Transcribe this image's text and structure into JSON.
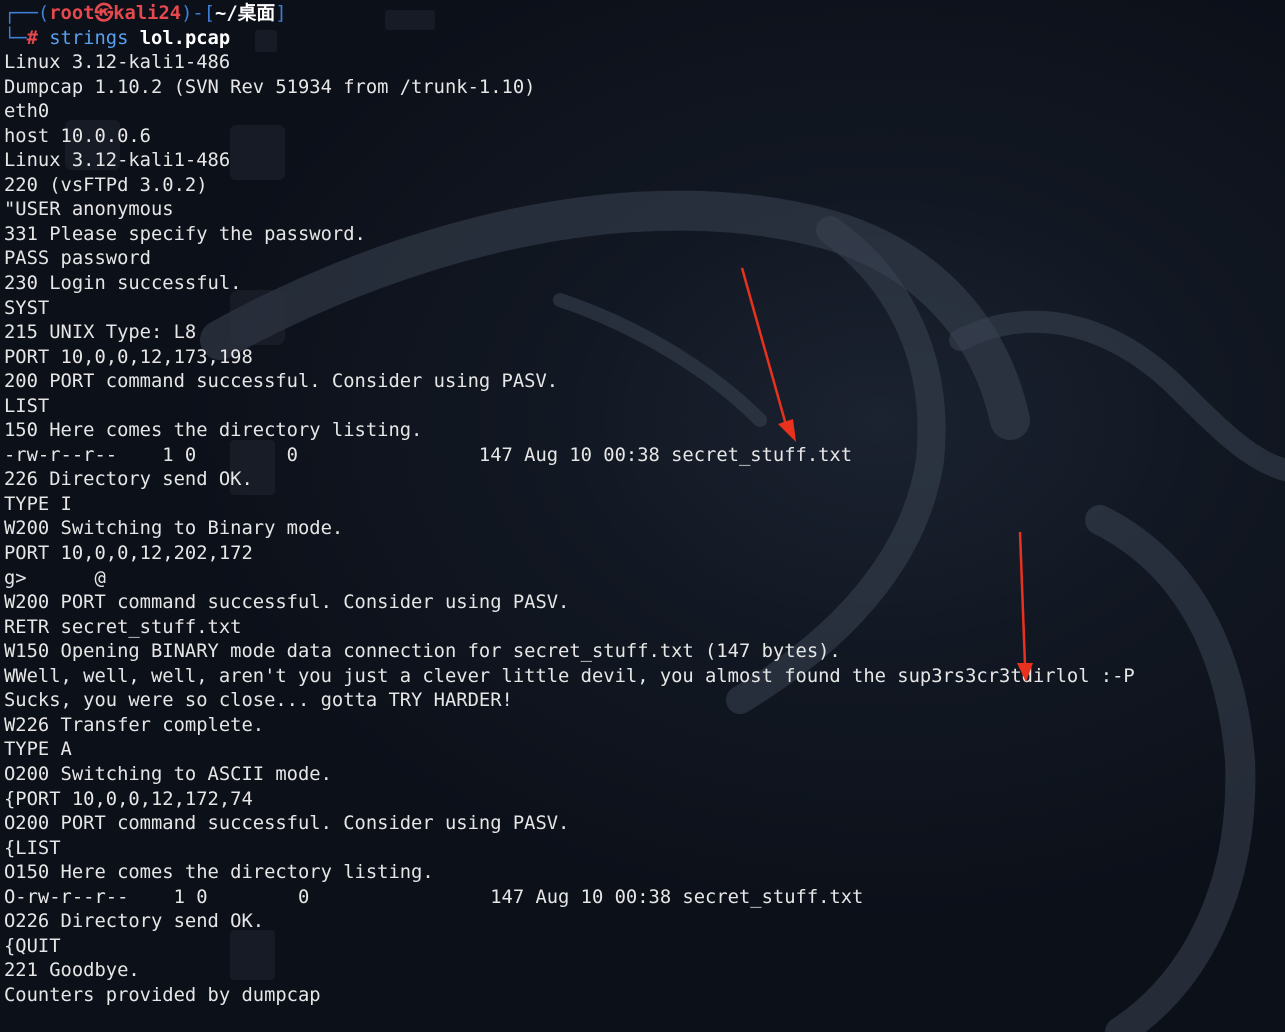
{
  "prompt": {
    "frame_open": "┌──(",
    "user": "root㉿kali24",
    "frame_mid": ")-[",
    "path": "~/桌面",
    "frame_close": "]",
    "frame_bottom": "└─",
    "hash": "#",
    "command": "strings",
    "argument": "lol.pcap"
  },
  "output_lines": [
    "Linux 3.12-kali1-486",
    "Dumpcap 1.10.2 (SVN Rev 51934 from /trunk-1.10)",
    "eth0",
    "host 10.0.0.6",
    "Linux 3.12-kali1-486",
    "220 (vsFTPd 3.0.2)",
    "\"USER anonymous",
    "331 Please specify the password.",
    "PASS password",
    "230 Login successful.",
    "SYST",
    "215 UNIX Type: L8",
    "PORT 10,0,0,12,173,198",
    "200 PORT command successful. Consider using PASV.",
    "LIST",
    "150 Here comes the directory listing.",
    "-rw-r--r--    1 0        0                147 Aug 10 00:38 secret_stuff.txt",
    "226 Directory send OK.",
    "TYPE I",
    "W200 Switching to Binary mode.",
    "PORT 10,0,0,12,202,172",
    "g>      @",
    "W200 PORT command successful. Consider using PASV.",
    "RETR secret_stuff.txt",
    "W150 Opening BINARY mode data connection for secret_stuff.txt (147 bytes).",
    "WWell, well, well, aren't you just a clever little devil, you almost found the sup3rs3cr3tdirlol :-P",
    "Sucks, you were so close... gotta TRY HARDER!",
    "W226 Transfer complete.",
    "TYPE A",
    "O200 Switching to ASCII mode.",
    "{PORT 10,0,0,12,172,74",
    "O200 PORT command successful. Consider using PASV.",
    "{LIST",
    "O150 Here comes the directory listing.",
    "O-rw-r--r--    1 0        0                147 Aug 10 00:38 secret_stuff.txt",
    "O226 Directory send OK.",
    "{QUIT",
    "221 Goodbye.",
    "Counters provided by dumpcap"
  ],
  "colors": {
    "background": "#0f141d",
    "text": "#e6e6e6",
    "prompt_frame": "#3f7dd6",
    "prompt_user": "#e5484d",
    "command": "#5aa0f0",
    "annotation_arrow": "#e8321e"
  }
}
